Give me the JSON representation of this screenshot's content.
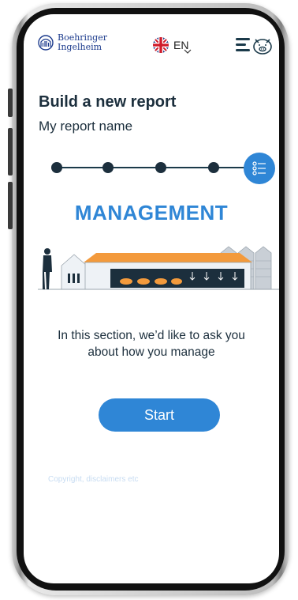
{
  "header": {
    "brand_line1": "Boehringer",
    "brand_line2": "Ingelheim",
    "language": "EN"
  },
  "report": {
    "title": "Build a new report",
    "name": "My report name"
  },
  "progress": {
    "total_steps": 5,
    "current_step": 5
  },
  "section": {
    "title": "MANAGEMENT",
    "description": "In this section, we’d like to ask you about how you manage"
  },
  "actions": {
    "start_label": "Start"
  },
  "footer": {
    "copyright": "Copyright, disclaimers etc"
  },
  "colors": {
    "accent": "#2f86d6",
    "dark": "#1c2f3d",
    "roof": "#f39a3c",
    "copyright": "#c7dcf2"
  },
  "icons": [
    "bi-logo",
    "uk-flag-icon",
    "chevron-down-icon",
    "hamburger-menu-icon",
    "pig-icon",
    "checklist-icon"
  ]
}
